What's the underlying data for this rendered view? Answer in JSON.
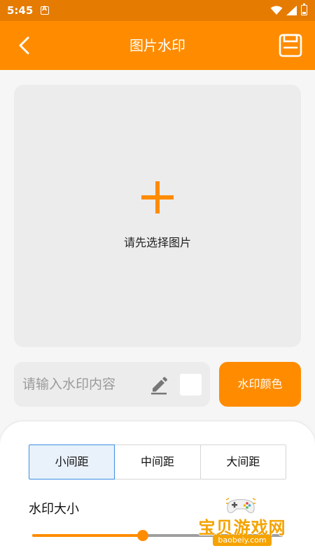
{
  "status_bar": {
    "time": "5:45"
  },
  "app_bar": {
    "title": "图片水印",
    "back_icon": "chevron-left-icon",
    "save_icon": "floppy-disk-icon"
  },
  "image_picker": {
    "hint": "请先选择图片",
    "icon": "plus-icon"
  },
  "watermark_input": {
    "placeholder": "请输入水印内容",
    "value": ""
  },
  "color_button": {
    "label": "水印颜色"
  },
  "spacing": {
    "options": [
      "小间距",
      "中间距",
      "大间距"
    ],
    "selected": "小间距"
  },
  "size": {
    "label": "水印大小",
    "value_fraction": 0.44
  },
  "watermark_logo": {
    "text": "宝贝游戏网",
    "url": "baobeiy.com"
  },
  "colors": {
    "accent": "#ff8c00",
    "status_bar": "#e57b00",
    "selected_border": "#3d8ee4",
    "selected_bg": "#e9f1fb"
  }
}
